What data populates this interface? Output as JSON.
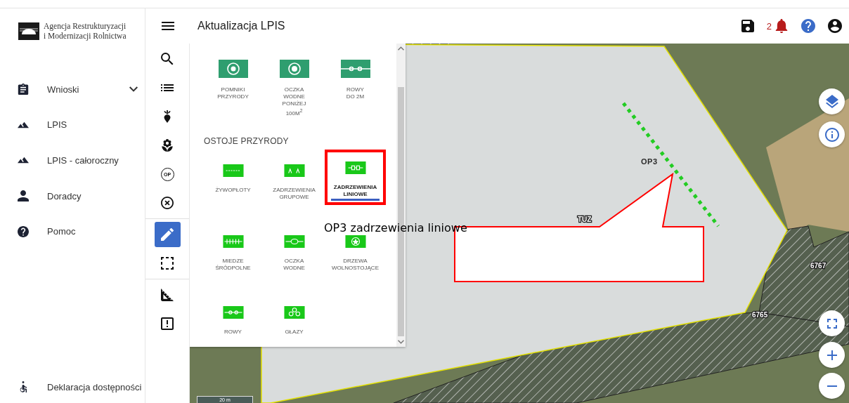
{
  "sidebar": {
    "logo": {
      "lines": [
        "Agencja Restrukturyzacji",
        "i Modernizacji Rolnictwa"
      ]
    },
    "items": [
      {
        "label": "Wnioski",
        "kind": "clipboard",
        "has_submenu": true
      },
      {
        "label": "LPIS",
        "kind": "terrain",
        "has_submenu": false
      },
      {
        "label": "LPIS - całoroczny",
        "kind": "terrain",
        "has_submenu": false
      },
      {
        "label": "Doradcy",
        "kind": "person",
        "has_submenu": false
      },
      {
        "label": "Pomoc",
        "kind": "help",
        "has_submenu": false
      }
    ],
    "footer": {
      "label": "Deklaracja dostępności",
      "kind": "accessible"
    }
  },
  "header": {
    "title": "Aktualizacja LPIS",
    "notification_count": "2"
  },
  "toolbar": {
    "groups": [
      {
        "tools": [
          {
            "kind": "search",
            "selected": false
          },
          {
            "kind": "list",
            "selected": false
          },
          {
            "kind": "beet",
            "selected": false
          },
          {
            "kind": "flower",
            "selected": false
          },
          {
            "kind": "badge",
            "text": "OP",
            "selected": false
          },
          {
            "kind": "cancel",
            "selected": false
          }
        ]
      },
      {
        "tools": [
          {
            "kind": "pencil",
            "selected": true
          },
          {
            "kind": "select",
            "selected": false
          }
        ]
      },
      {
        "tools": [
          {
            "kind": "ruler",
            "selected": false
          },
          {
            "kind": "report",
            "selected": false
          }
        ]
      }
    ]
  },
  "layer_panel": {
    "sections": [
      {
        "items": [
          {
            "label": "POMNIKI\nPRZYRODY",
            "kind": "monument",
            "selected": false,
            "highlighted": false
          },
          {
            "label": "OCZKA\nWODNE\nPONIŻEJ\n100M$^{2}$",
            "kind": "pond-small",
            "selected": false,
            "highlighted": false
          },
          {
            "label": "ROWY\nDO 2M",
            "kind": "ditch-small",
            "selected": false,
            "highlighted": false
          }
        ]
      },
      {
        "title": "OSTOJE PRZYRODY",
        "items": [
          {
            "label": "ŻYWOPŁOTY",
            "kind": "hedge",
            "selected": false,
            "highlighted": false
          },
          {
            "label": "ZADRZEWIENIA\nGRUPOWE",
            "kind": "tree-group",
            "selected": false,
            "highlighted": false
          },
          {
            "label": "ZADRZEWIENIA\nLINIOWE",
            "kind": "tree-line",
            "selected": true,
            "highlighted": true
          },
          {
            "label": "MIEDZE\nŚRÓDPOLNE",
            "kind": "balk",
            "selected": false,
            "highlighted": false
          },
          {
            "label": "OCZKA\nWODNE",
            "kind": "pond",
            "selected": false,
            "highlighted": false
          },
          {
            "label": "DRZEWA\nWOLNOSTOJĄCE",
            "kind": "tree",
            "selected": false,
            "highlighted": false
          },
          {
            "label": "ROWY",
            "kind": "ditch",
            "selected": false,
            "highlighted": false
          },
          {
            "label": "GŁAZY",
            "kind": "boulders",
            "selected": false,
            "highlighted": false
          }
        ]
      }
    ]
  },
  "map": {
    "labels": [
      {
        "text": "OP3",
        "kind": "feature"
      },
      {
        "text": "TUZ",
        "kind": "parcel"
      },
      {
        "text": "6767",
        "kind": "parcel"
      },
      {
        "text": "6765",
        "kind": "parcel"
      }
    ],
    "scale": "20 m",
    "controls": [
      {
        "kind": "layers"
      },
      {
        "kind": "info"
      },
      {
        "kind": "fullscreen"
      },
      {
        "kind": "zoom-in"
      },
      {
        "kind": "zoom-out"
      }
    ]
  },
  "annotation": {
    "text": "OP3 zadrzewienia liniowe"
  }
}
